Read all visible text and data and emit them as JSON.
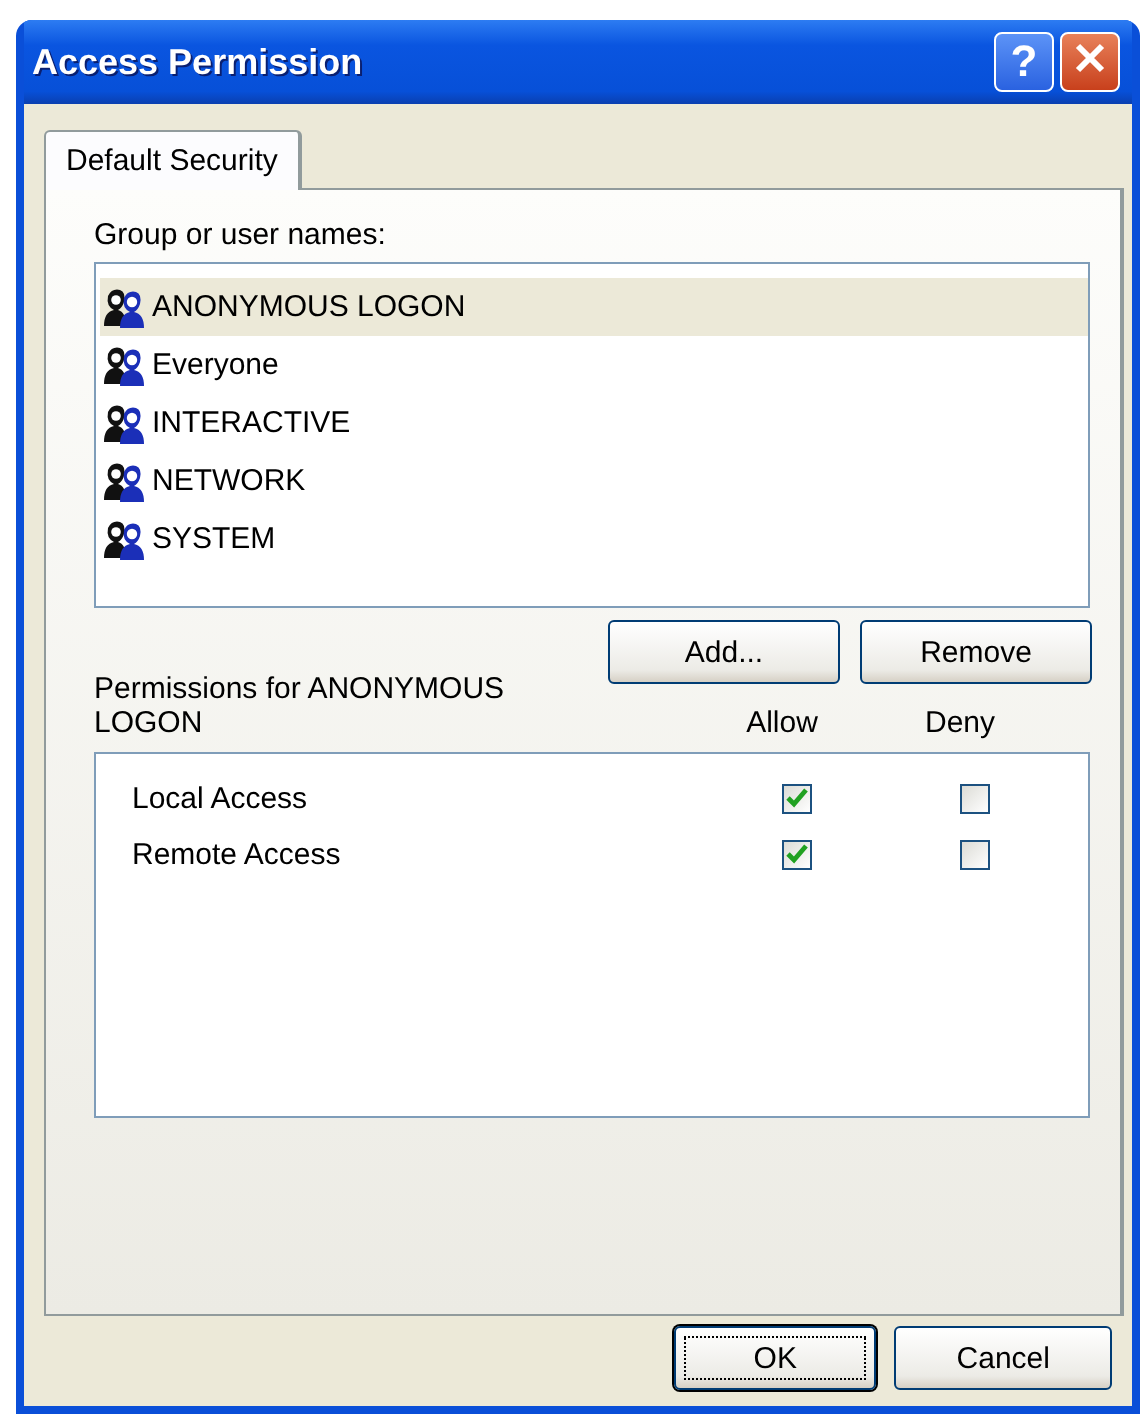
{
  "window": {
    "title": "Access Permission",
    "help": "?"
  },
  "tabs": [
    {
      "label": "Default Security",
      "selected": true
    }
  ],
  "group_label": "Group or user names:",
  "users": [
    {
      "name": "ANONYMOUS LOGON",
      "selected": true
    },
    {
      "name": "Everyone",
      "selected": false
    },
    {
      "name": "INTERACTIVE",
      "selected": false
    },
    {
      "name": "NETWORK",
      "selected": false
    },
    {
      "name": "SYSTEM",
      "selected": false
    }
  ],
  "user_buttons": [
    "Add...",
    "Remove"
  ],
  "permissions_label": "Permissions for ANONYMOUS LOGON",
  "permission_columns": [
    "Allow",
    "Deny"
  ],
  "permissions": [
    {
      "name": "Local Access",
      "allow": true,
      "deny": false
    },
    {
      "name": "Remote Access",
      "allow": true,
      "deny": false
    }
  ],
  "dialog_buttons": [
    {
      "label": "OK",
      "default": true
    },
    {
      "label": "Cancel",
      "default": false
    }
  ]
}
